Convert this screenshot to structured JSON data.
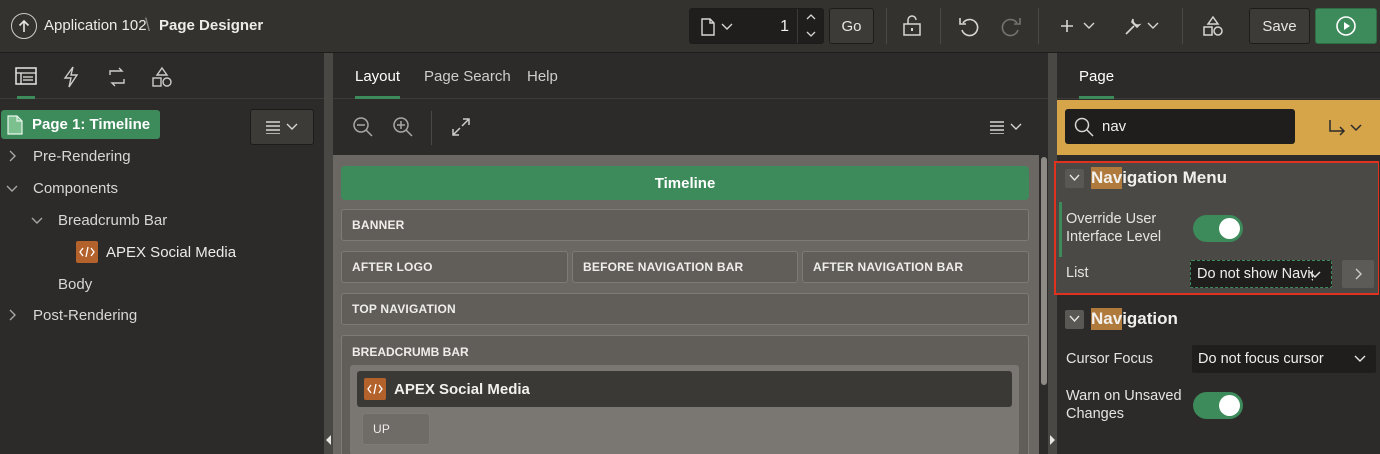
{
  "header": {
    "app_name": "Application 102",
    "separator": "\\",
    "page_title": "Page Designer",
    "page_number": "1",
    "go_label": "Go",
    "save_label": "Save"
  },
  "left": {
    "root_label": "Page 1: Timeline",
    "tree": [
      {
        "label": "Pre-Rendering"
      },
      {
        "label": "Components"
      },
      {
        "label": "Breadcrumb Bar"
      },
      {
        "label": "APEX Social Media"
      },
      {
        "label": "Body"
      },
      {
        "label": "Post-Rendering"
      }
    ]
  },
  "center": {
    "tabs": [
      "Layout",
      "Page Search",
      "Help"
    ],
    "page_region": "Timeline",
    "regions": {
      "banner": "BANNER",
      "after_logo": "AFTER LOGO",
      "before_nav": "BEFORE NAVIGATION BAR",
      "after_nav": "AFTER NAVIGATION BAR",
      "top_nav": "TOP NAVIGATION",
      "breadcrumb_bar": "BREADCRUMB BAR",
      "breadcrumb_component": "APEX Social Media",
      "up": "UP"
    }
  },
  "right": {
    "tab": "Page",
    "search_value": "nav",
    "groups": [
      {
        "title_highlight": "Nav",
        "title_rest": "igation Menu",
        "props": [
          {
            "label_line1": "Override User",
            "label_line2": "Interface Level",
            "toggle": true
          },
          {
            "label": "List",
            "value": "Do not show Navigation Menu List"
          }
        ]
      },
      {
        "title_highlight": "Nav",
        "title_rest": "igation",
        "props": [
          {
            "label": "Cursor Focus",
            "value": "Do not focus cursor"
          },
          {
            "label_line1": "Warn on Unsaved",
            "label_line2": "Changes",
            "toggle": true
          }
        ]
      }
    ]
  },
  "colors": {
    "accent_green": "#3d8a5a",
    "search_bar": "#d6a54a",
    "highlight_box": "#e0321f",
    "search_highlight": "#b07a3c"
  }
}
